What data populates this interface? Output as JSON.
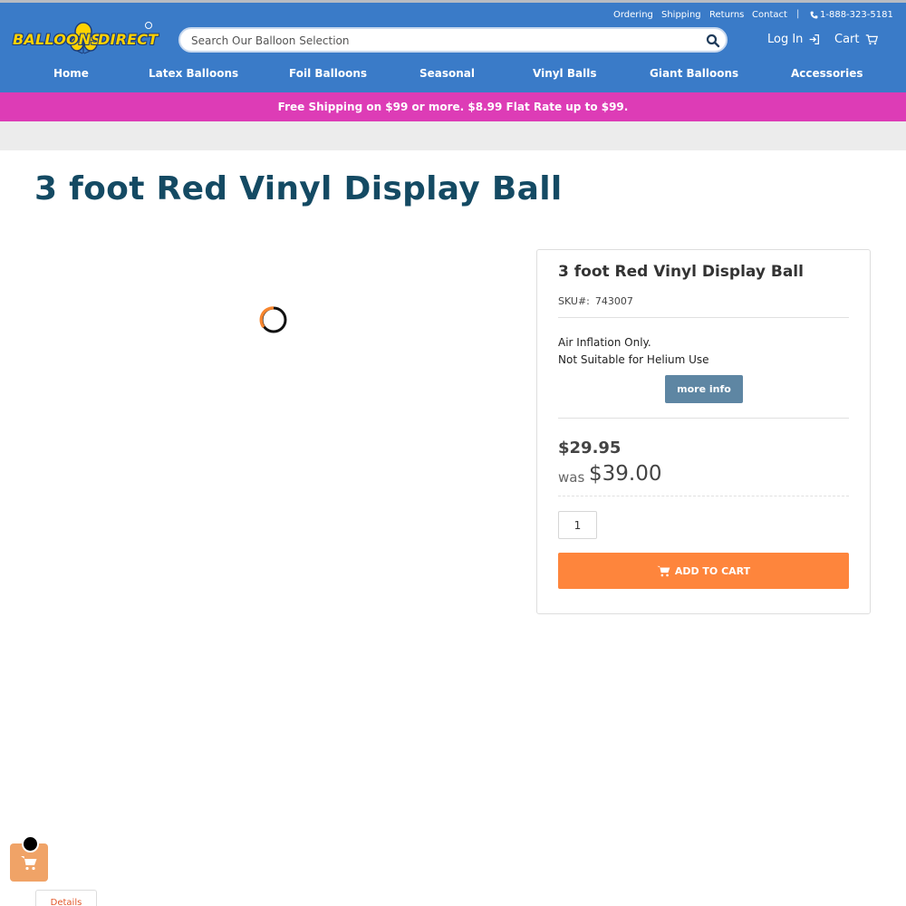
{
  "brand": {
    "logo_word1": "BALLOONS",
    "logo_word2": "DIRECT",
    "registered": "®",
    "yellow": "#ffd200",
    "header_blue": "#3a7bc8"
  },
  "utility_nav": {
    "items": [
      "Ordering",
      "Shipping",
      "Returns",
      "Contact"
    ],
    "separator": "|",
    "phone": "1-888-323-5181",
    "phone_icon": "phone-icon"
  },
  "search": {
    "placeholder": "Search Our Balloon Selection",
    "value": "",
    "icon": "search-icon"
  },
  "account": {
    "login_label": "Log In",
    "login_icon": "sign-in-icon",
    "cart_label": "Cart",
    "cart_icon": "shopping-cart-icon"
  },
  "main_nav": {
    "items": [
      "Home",
      "Latex Balloons",
      "Foil Balloons",
      "Seasonal",
      "Vinyl Balls",
      "Giant Balloons",
      "Accessories"
    ]
  },
  "promo": {
    "text": "Free Shipping on $99 or more. $8.99 Flat Rate up to $99.",
    "color": "#dd3cb6"
  },
  "product": {
    "page_title": "3 foot Red Vinyl Display Ball",
    "panel_title": "3 foot Red Vinyl Display Ball",
    "sku_label": "SKU#:",
    "sku": "743007",
    "description_lines": [
      "Air Inflation Only.",
      "Not Suitable for Helium Use"
    ],
    "more_info_label": "more info",
    "price": "$29.95",
    "was_label": "was",
    "was_price": "$39.00",
    "quantity": "1",
    "add_to_cart_label": "ADD TO CART",
    "cta_color": "#fe853c"
  },
  "image_area": {
    "loading_icon": "loading-spinner-icon"
  },
  "floating": {
    "cart_icon": "shopping-cart-icon",
    "details_tab_label": "Details"
  }
}
